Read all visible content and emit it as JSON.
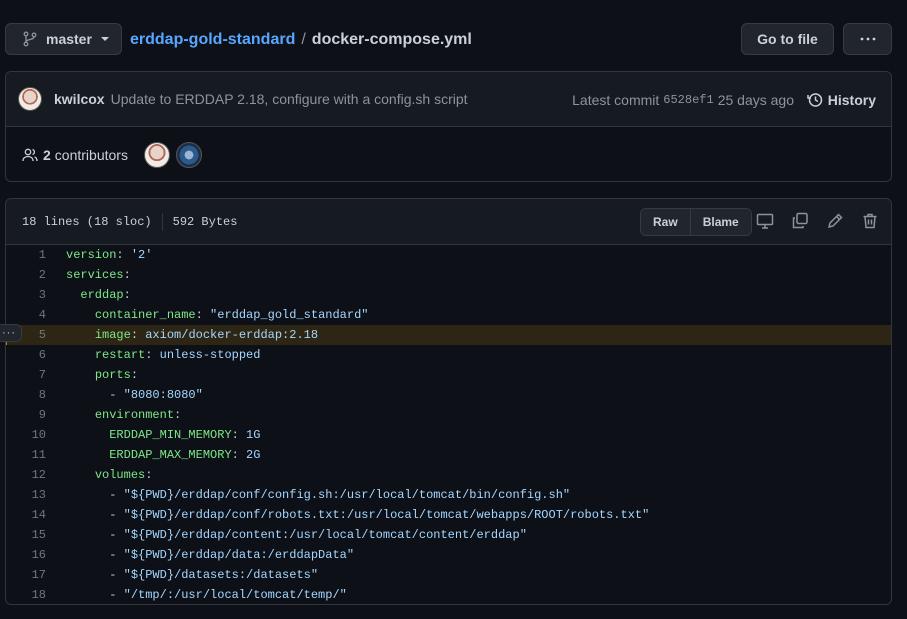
{
  "topbar": {
    "branch": "master",
    "repo": "erddap-gold-standard",
    "separator": "/",
    "file": "docker-compose.yml",
    "goto_label": "Go to file"
  },
  "commit": {
    "author": "kwilcox",
    "message": "Update to ERDDAP 2.18, configure with a config.sh script",
    "latest_label": "Latest commit",
    "sha": "6528ef1",
    "age": "25 days ago",
    "history_label": "History"
  },
  "contributors": {
    "count": "2",
    "label": "contributors"
  },
  "file": {
    "lines_info": "18 lines (18 sloc)",
    "size": "592 Bytes",
    "raw_label": "Raw",
    "blame_label": "Blame"
  },
  "code": {
    "highlighted_line": 5,
    "lines": [
      {
        "n": "1",
        "indent": "",
        "key": "version",
        "sep": ": ",
        "val": "'2'",
        "dash": ""
      },
      {
        "n": "2",
        "indent": "",
        "key": "services",
        "sep": ":",
        "val": "",
        "dash": ""
      },
      {
        "n": "3",
        "indent": "  ",
        "key": "erddap",
        "sep": ":",
        "val": "",
        "dash": ""
      },
      {
        "n": "4",
        "indent": "    ",
        "key": "container_name",
        "sep": ": ",
        "val": "\"erddap_gold_standard\"",
        "dash": ""
      },
      {
        "n": "5",
        "indent": "    ",
        "key": "image",
        "sep": ": ",
        "val": "axiom/docker-erddap:2.18",
        "dash": ""
      },
      {
        "n": "6",
        "indent": "    ",
        "key": "restart",
        "sep": ": ",
        "val": "unless-stopped",
        "dash": ""
      },
      {
        "n": "7",
        "indent": "    ",
        "key": "ports",
        "sep": ":",
        "val": "",
        "dash": ""
      },
      {
        "n": "8",
        "indent": "      ",
        "key": "",
        "sep": "",
        "val": "\"8080:8080\"",
        "dash": "- "
      },
      {
        "n": "9",
        "indent": "    ",
        "key": "environment",
        "sep": ":",
        "val": "",
        "dash": ""
      },
      {
        "n": "10",
        "indent": "      ",
        "key": "ERDDAP_MIN_MEMORY",
        "sep": ": ",
        "val": "1G",
        "dash": ""
      },
      {
        "n": "11",
        "indent": "      ",
        "key": "ERDDAP_MAX_MEMORY",
        "sep": ": ",
        "val": "2G",
        "dash": ""
      },
      {
        "n": "12",
        "indent": "    ",
        "key": "volumes",
        "sep": ":",
        "val": "",
        "dash": ""
      },
      {
        "n": "13",
        "indent": "      ",
        "key": "",
        "sep": "",
        "val": "\"${PWD}/erddap/conf/config.sh:/usr/local/tomcat/bin/config.sh\"",
        "dash": "- "
      },
      {
        "n": "14",
        "indent": "      ",
        "key": "",
        "sep": "",
        "val": "\"${PWD}/erddap/conf/robots.txt:/usr/local/tomcat/webapps/ROOT/robots.txt\"",
        "dash": "- "
      },
      {
        "n": "15",
        "indent": "      ",
        "key": "",
        "sep": "",
        "val": "\"${PWD}/erddap/content:/usr/local/tomcat/content/erddap\"",
        "dash": "- "
      },
      {
        "n": "16",
        "indent": "      ",
        "key": "",
        "sep": "",
        "val": "\"${PWD}/erddap/data:/erddapData\"",
        "dash": "- "
      },
      {
        "n": "17",
        "indent": "      ",
        "key": "",
        "sep": "",
        "val": "\"${PWD}/datasets:/datasets\"",
        "dash": "- "
      },
      {
        "n": "18",
        "indent": "      ",
        "key": "",
        "sep": "",
        "val": "\"/tmp/:/usr/local/tomcat/temp/\"",
        "dash": "- "
      }
    ]
  }
}
